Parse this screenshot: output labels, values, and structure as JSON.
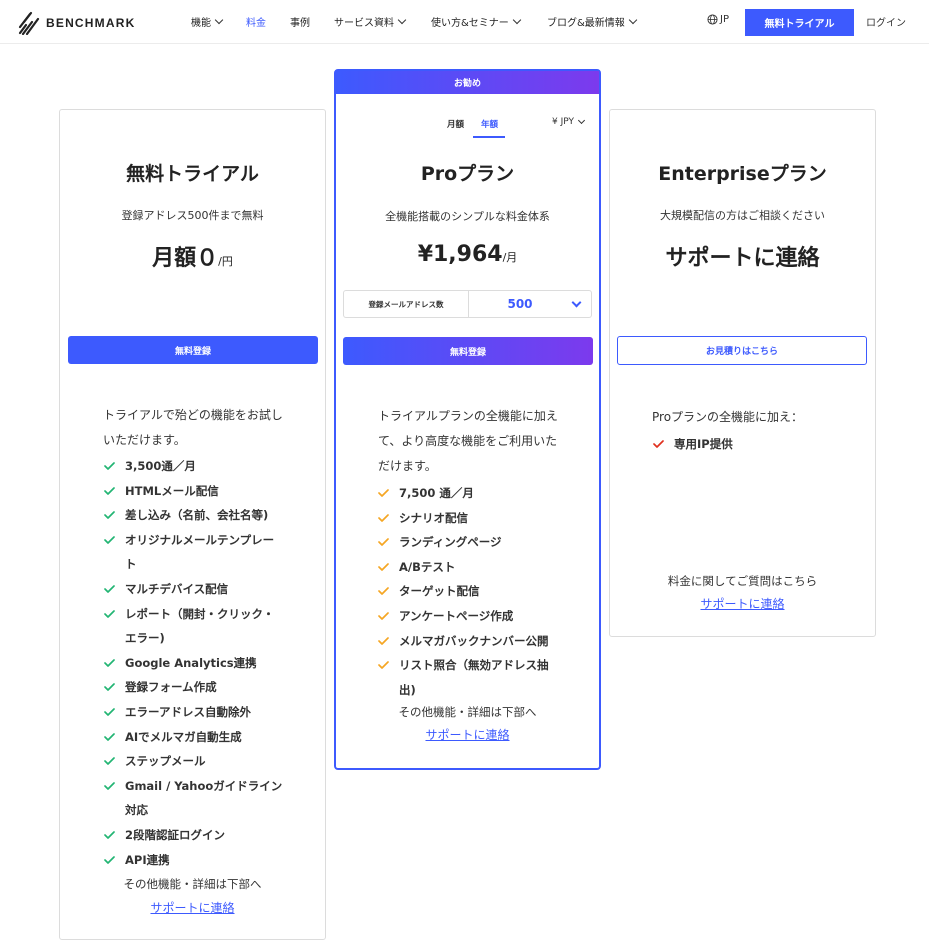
{
  "header": {
    "logo_text": "BENCHMARK",
    "nav": [
      {
        "label": "機能",
        "dropdown": true,
        "active": false
      },
      {
        "label": "料金",
        "dropdown": false,
        "active": true
      },
      {
        "label": "事例",
        "dropdown": false,
        "active": false
      },
      {
        "label": "サービス資料",
        "dropdown": true,
        "active": false
      },
      {
        "label": "使い方&セミナー",
        "dropdown": true,
        "active": false
      },
      {
        "label": "ブログ&最新情報",
        "dropdown": true,
        "active": false
      }
    ],
    "lang": "JP",
    "trial_button": "無料トライアル",
    "login": "ログイン"
  },
  "free": {
    "title": "無料トライアル",
    "subtitle": "登録アドレス500件まで無料",
    "price_main": "月額０",
    "price_unit": "/円",
    "button": "無料登録",
    "intro": [
      "トライアルで殆どの機能をお試し",
      "いただけます。"
    ],
    "features": [
      [
        "3,500通／月"
      ],
      [
        "HTMLメール配信"
      ],
      [
        "差し込み（名前、会社名等)"
      ],
      [
        "オリジナルメールテンプレー",
        "ト"
      ],
      [
        "マルチデバイス配信"
      ],
      [
        "レポート（開封・クリック・",
        "エラー)"
      ],
      [
        "Google Analytics連携"
      ],
      [
        "登録フォーム作成"
      ],
      [
        "エラーアドレス自動除外"
      ],
      [
        "AIでメルマガ自動生成"
      ],
      [
        "ステップメール"
      ],
      [
        "Gmail / Yahooガイドライン",
        "対応"
      ],
      [
        "2段階認証ログイン"
      ],
      [
        "API連携"
      ]
    ],
    "more": "その他機能・詳細は下部へ",
    "link": "サポートに連絡"
  },
  "pro": {
    "badge": "お勧め",
    "toggle_monthly": "月額",
    "toggle_yearly": "年額",
    "currency": "¥ JPY",
    "title": "Proプラン",
    "subtitle": "全機能搭載のシンプルな料金体系",
    "price_main": "¥1,964",
    "price_unit": "/月",
    "selector_label": "登録メールアドレス数",
    "selector_value": "500",
    "button": "無料登録",
    "intro": [
      "トライアルプランの全機能に加え",
      "て、より高度な機能をご利用いた",
      "だけます。"
    ],
    "features": [
      [
        "7,500 通／月"
      ],
      [
        "シナリオ配信"
      ],
      [
        "ランディングページ"
      ],
      [
        "A/Bテスト"
      ],
      [
        "ターゲット配信"
      ],
      [
        "アンケートページ作成"
      ],
      [
        "メルマガバックナンバー公開"
      ],
      [
        "リスト照合（無効アドレス抽",
        "出)"
      ]
    ],
    "more": "その他機能・詳細は下部へ",
    "link": "サポートに連絡"
  },
  "enterprise": {
    "title": "Enterpriseプラン",
    "subtitle": "大規模配信の方はご相談ください",
    "price_main": "サポートに連絡",
    "button": "お見積りはこちら",
    "intro": "Proプランの全機能に加え：",
    "features": [
      [
        "専用IP提供"
      ]
    ],
    "question": "料金に関してご質問はこちら",
    "link": "サポートに連絡"
  },
  "colors": {
    "accent": "#3d5afe",
    "gradient_end": "#7c3aed",
    "check_free": "#22b573",
    "check_pro": "#f5a623",
    "check_enterprise": "#e0301e"
  }
}
